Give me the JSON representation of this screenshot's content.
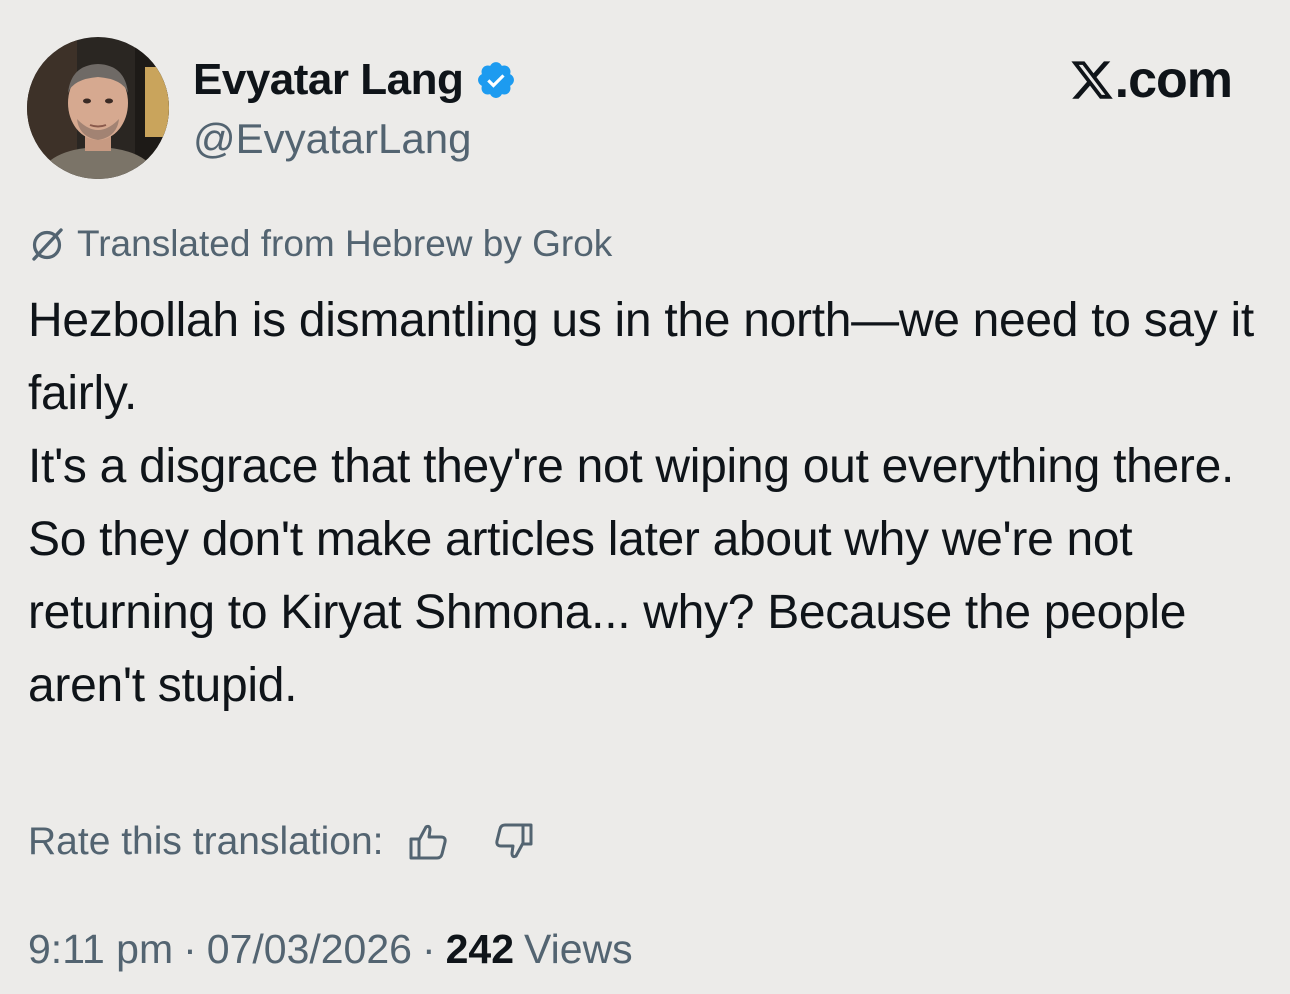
{
  "author": {
    "display_name": "Evyatar Lang",
    "handle": "@EvyatarLang",
    "verified": true,
    "verified_color": "#1d9bf0"
  },
  "brand": {
    "site": ".com",
    "icon": "x-logo-icon"
  },
  "translation": {
    "notice": "Translated from Hebrew by Grok",
    "icon": "grok-icon",
    "rate_label": "Rate this translation:",
    "rate_up_icon": "thumbs-up-icon",
    "rate_down_icon": "thumbs-down-icon"
  },
  "tweet": {
    "paragraphs": [
      "Hezbollah is dismantling us in the north—we need to say it fairly.",
      "It's a disgrace that they're not wiping out everything there.",
      "So they don't make articles later about why we're not returning to Kiryat Shmona... why? Because the people aren't stupid."
    ]
  },
  "meta": {
    "time": "9:11 pm",
    "date": "07/03/2026",
    "views_count": "242",
    "views_label": "Views",
    "separator": "·"
  },
  "colors": {
    "background": "#ecebe9",
    "text_primary": "#0f1419",
    "text_secondary": "#536471"
  }
}
